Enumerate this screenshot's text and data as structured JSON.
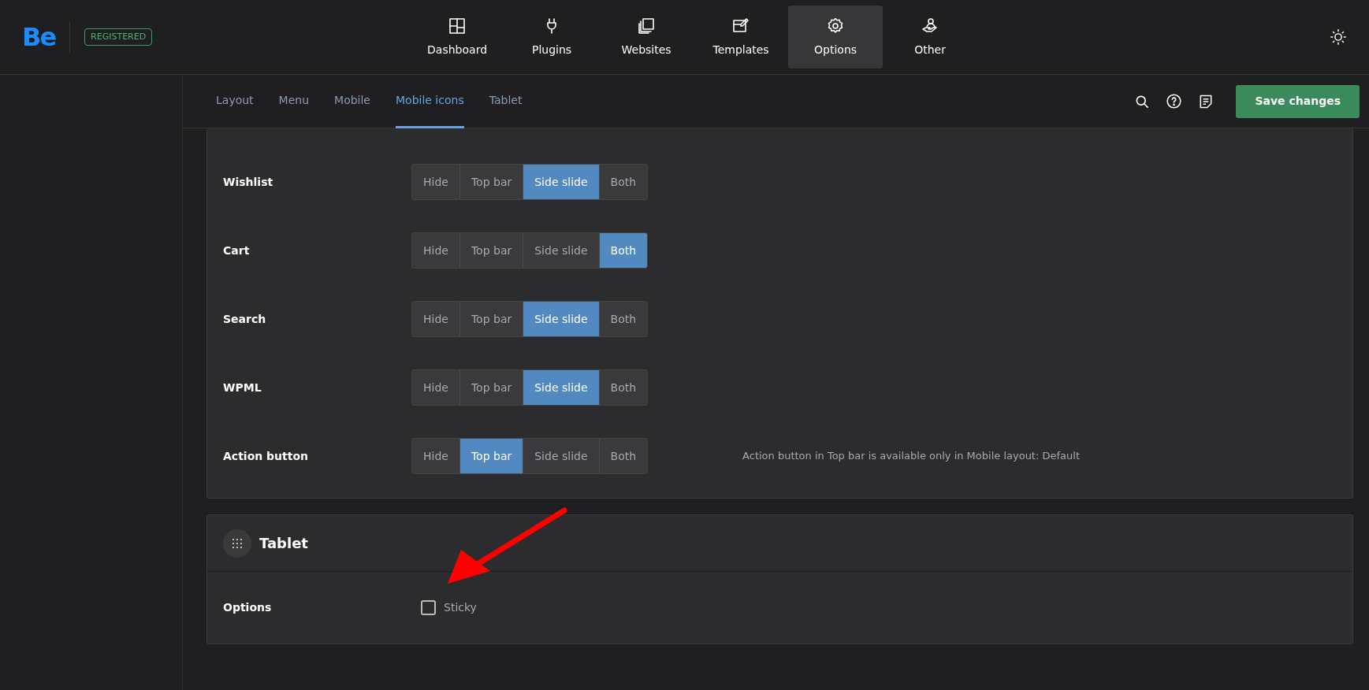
{
  "header": {
    "logo": "Be",
    "badge": "REGISTERED",
    "nav": [
      {
        "label": "Dashboard",
        "selected": false
      },
      {
        "label": "Plugins",
        "selected": false
      },
      {
        "label": "Websites",
        "selected": false
      },
      {
        "label": "Templates",
        "selected": false
      },
      {
        "label": "Options",
        "selected": true
      },
      {
        "label": "Other",
        "selected": false
      }
    ]
  },
  "tabs": [
    {
      "label": "Layout",
      "selected": false
    },
    {
      "label": "Menu",
      "selected": false
    },
    {
      "label": "Mobile",
      "selected": false
    },
    {
      "label": "Mobile icons",
      "selected": true
    },
    {
      "label": "Tablet",
      "selected": false
    }
  ],
  "save_button": "Save changes",
  "mobile_icons": {
    "rows": [
      {
        "label": "Wishlist",
        "options": [
          {
            "label": "Hide",
            "selected": false
          },
          {
            "label": "Top bar",
            "selected": false
          },
          {
            "label": "Side slide",
            "selected": true
          },
          {
            "label": "Both",
            "selected": false
          }
        ]
      },
      {
        "label": "Cart",
        "options": [
          {
            "label": "Hide",
            "selected": false
          },
          {
            "label": "Top bar",
            "selected": false
          },
          {
            "label": "Side slide",
            "selected": false
          },
          {
            "label": "Both",
            "selected": true
          }
        ]
      },
      {
        "label": "Search",
        "options": [
          {
            "label": "Hide",
            "selected": false
          },
          {
            "label": "Top bar",
            "selected": false
          },
          {
            "label": "Side slide",
            "selected": true
          },
          {
            "label": "Both",
            "selected": false
          }
        ]
      },
      {
        "label": "WPML",
        "options": [
          {
            "label": "Hide",
            "selected": false
          },
          {
            "label": "Top bar",
            "selected": false
          },
          {
            "label": "Side slide",
            "selected": true
          },
          {
            "label": "Both",
            "selected": false
          }
        ]
      },
      {
        "label": "Action button",
        "options": [
          {
            "label": "Hide",
            "selected": false
          },
          {
            "label": "Top bar",
            "selected": true
          },
          {
            "label": "Side slide",
            "selected": false
          },
          {
            "label": "Both",
            "selected": false
          }
        ],
        "note": "Action button in Top bar is available only in Mobile layout: Default"
      }
    ]
  },
  "tablet": {
    "title": "Tablet",
    "rows": [
      {
        "label": "Options",
        "checkbox": {
          "label": "Sticky",
          "checked": false
        }
      }
    ]
  }
}
